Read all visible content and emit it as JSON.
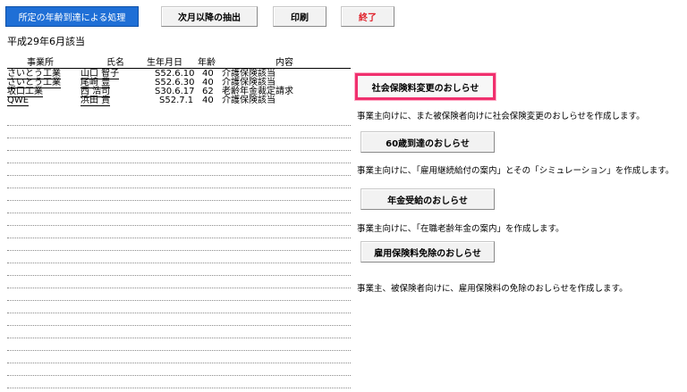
{
  "toolbar": {
    "tab_label": "所定の年齢到達による処理",
    "next_month_label": "次月以降の抽出",
    "print_label": "印刷",
    "exit_label": "終了"
  },
  "period_label": "平成29年6月該当",
  "table": {
    "headers": [
      "事業所",
      "氏名",
      "生年月日",
      "年齢",
      "内容"
    ],
    "rows": [
      [
        "さいとう工業",
        "山口 智子",
        "S52.6.10",
        "40",
        "介護保険該当"
      ],
      [
        "さいとう工業",
        "尾崎 豊",
        "S52.6.30",
        "40",
        "介護保険該当"
      ],
      [
        "坂口工業",
        "西 浩司",
        "S30.6.17",
        "62",
        "老齢年金裁定請求"
      ],
      [
        "QWE",
        "浜田 貴",
        "S52.7.1",
        "40",
        "介護保険該当"
      ]
    ]
  },
  "notices": [
    {
      "button_label": "社会保険料変更のおしらせ",
      "description": "事業主向けに、また被保険者向けに社会保険変更のおしらせを作成します。"
    },
    {
      "button_label": "60歳到達のおしらせ",
      "description": "事業主向けに、「雇用継続給付の案内」とその「シミュレーション」を作成します。"
    },
    {
      "button_label": "年金受給のおしらせ",
      "description": "事業主向けに、「在職老齢年金の案内」を作成します。"
    },
    {
      "button_label": "雇用保険料免除のおしらせ",
      "description": "事業主、被保険者向けに、雇用保険料の免除のおしらせを作成します。"
    }
  ]
}
